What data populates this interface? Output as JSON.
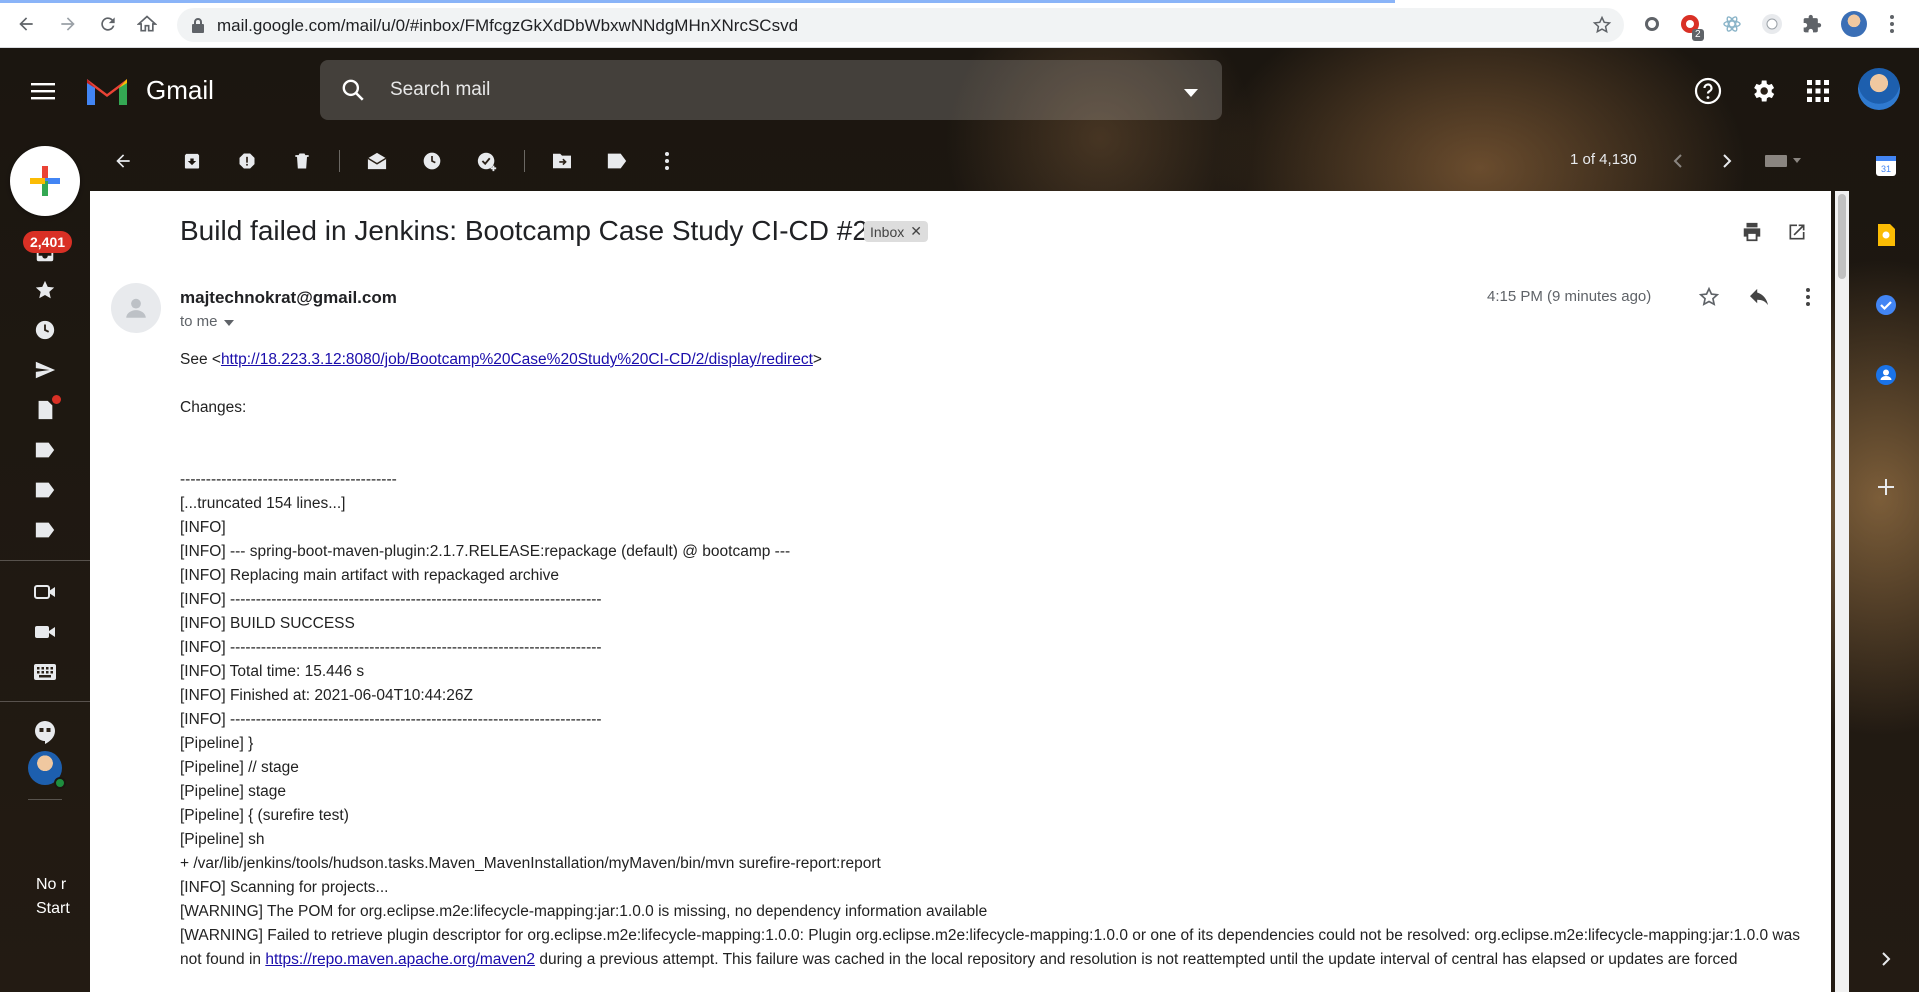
{
  "browser": {
    "url": "mail.google.com/mail/u/0/#inbox/FMfcgzGkXdDbWbxwNNdgMHnXNrcSCsvd",
    "extension_badge": "2"
  },
  "app": {
    "name": "Gmail",
    "search_placeholder": "Search mail"
  },
  "rail": {
    "inbox_count": "2,401",
    "meet_text_1": "No r",
    "meet_text_2": "Start"
  },
  "toolbar": {
    "pager": "1 of 4,130"
  },
  "message": {
    "subject": "Build failed in Jenkins: Bootcamp Case Study CI-CD #2",
    "label": "Inbox",
    "sender": "majtechnokrat@gmail.com",
    "to": "to me",
    "time": "4:15 PM (9 minutes ago)",
    "see_prefix": "See <",
    "see_link": "http://18.223.3.12:8080/job/Bootcamp%20Case%20Study%20CI-CD/2/display/redirect",
    "see_suffix": ">",
    "changes": "Changes:",
    "log_lines": [
      "------------------------------------------",
      "[...truncated 154 lines...]",
      "[INFO]",
      "[INFO] --- spring-boot-maven-plugin:2.1.7.RELEASE:repackage (default) @ bootcamp ---",
      "[INFO] Replacing main artifact with repackaged archive",
      "[INFO] ------------------------------------------------------------------------",
      "[INFO] BUILD SUCCESS",
      "[INFO] ------------------------------------------------------------------------",
      "[INFO] Total time:  15.446 s",
      "[INFO] Finished at: 2021-06-04T10:44:26Z",
      "[INFO] ------------------------------------------------------------------------",
      "[Pipeline] }",
      "[Pipeline] // stage",
      "[Pipeline] stage",
      "[Pipeline] { (surefire test)",
      "[Pipeline] sh",
      "+ /var/lib/jenkins/tools/hudson.tasks.Maven_MavenInstallation/myMaven/bin/mvn surefire-report:report",
      "[INFO] Scanning for projects...",
      "[WARNING] The POM for org.eclipse.m2e:lifecycle-mapping:jar:1.0.0 is missing, no dependency information available"
    ],
    "warning_part1": "[WARNING] Failed to retrieve plugin descriptor for org.eclipse.m2e:lifecycle-mapping:1.0.0: Plugin org.eclipse.m2e:lifecycle-mapping:1.0.0 or one of its dependencies could not be resolved: org.eclipse.m2e:lifecycle-mapping:jar:1.0.0 was not found in ",
    "warning_link": "https://repo.maven.apache.org/maven2",
    "warning_part2": " during a previous attempt. This failure was cached in the local repository and resolution is not reattempted until the update interval of central has elapsed or updates are forced"
  }
}
